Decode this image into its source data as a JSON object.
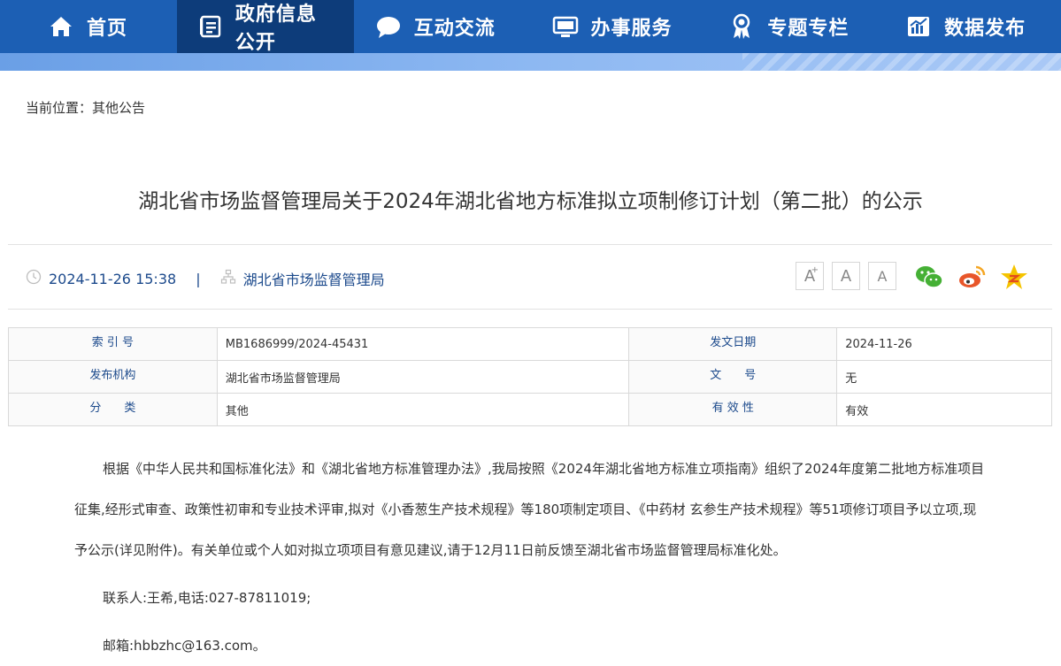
{
  "nav": {
    "items": [
      {
        "label": "首页",
        "icon": "home-icon"
      },
      {
        "label": "政府信息公开",
        "icon": "document-list-icon",
        "active": true
      },
      {
        "label": "互动交流",
        "icon": "chat-bubble-icon"
      },
      {
        "label": "办事服务",
        "icon": "monitor-icon"
      },
      {
        "label": "专题专栏",
        "icon": "award-ribbon-icon"
      },
      {
        "label": "数据发布",
        "icon": "bar-chart-icon"
      }
    ],
    "color": "#1c5fb4",
    "active_color": "#0d3c7a"
  },
  "breadcrumb": {
    "prefix": "当前位置：",
    "current": "其他公告"
  },
  "article": {
    "title": "湖北省市场监督管理局关于2024年湖北省地方标准拟立项制修订计划（第二批）的公示",
    "datetime": "2024-11-26 15:38",
    "separator": "|",
    "publisher": "湖北省市场监督管理局"
  },
  "font_controls": {
    "increase": "A",
    "increase_mark": "+",
    "normal": "A",
    "decrease": "A"
  },
  "share": [
    "wechat-icon",
    "weibo-icon",
    "qzone-icon"
  ],
  "meta_table": {
    "rows": [
      [
        {
          "k": "索 引 号",
          "v": "MB1686999/2024-45431"
        },
        {
          "k": "发文日期",
          "v": "2024-11-26"
        }
      ],
      [
        {
          "k": "发布机构",
          "v": "湖北省市场监督管理局"
        },
        {
          "k": "文　　号",
          "v": "无"
        }
      ],
      [
        {
          "k": "分　　类",
          "v": "其他"
        },
        {
          "k": "有 效 性",
          "v": "有效"
        }
      ]
    ]
  },
  "body": {
    "paragraph": "根据《中华人民共和国标准化法》和《湖北省地方标准管理办法》,我局按照《2024年湖北省地方标准立项指南》组织了2024年度第二批地方标准项目征集,经形式审查、政策性初审和专业技术评审,拟对《小香葱生产技术规程》等180项制定项目、《中药材 玄参生产技术规程》等51项修订项目予以立项,现予公示(详见附件)。有关单位或个人如对拟立项项目有意见建议,请于12月11日前反馈至湖北省市场监督管理局标准化处。",
    "contact": "联系人:王希,电话:027-87811019;",
    "email": "邮箱:hbbzhc@163.com。"
  }
}
